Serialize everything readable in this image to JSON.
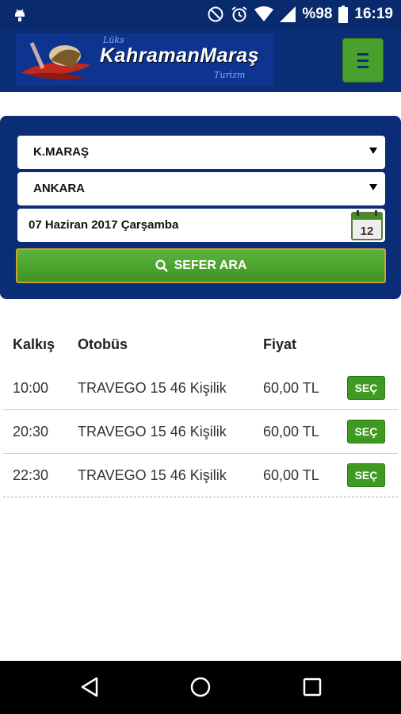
{
  "status_bar": {
    "battery": "%98",
    "time": "16:19",
    "icons": [
      "android-debug-icon",
      "do-not-disturb-icon",
      "alarm-icon",
      "wifi-icon",
      "signal-icon",
      "battery-icon"
    ]
  },
  "header": {
    "logo_tag_top": "Lüks",
    "logo_brand": "KahramanMaraş",
    "logo_tag_bottom": "Turizm",
    "menu_icon": "hamburger-icon"
  },
  "search": {
    "from": "K.MARAŞ",
    "to": "ANKARA",
    "date": "07 Haziran 2017 Çarşamba",
    "calendar_day": "12",
    "button_label": "SEFER ARA"
  },
  "results": {
    "headers": {
      "departure": "Kalkış",
      "bus": "Otobüs",
      "price": "Fiyat"
    },
    "rows": [
      {
        "time": "10:00",
        "bus": "TRAVEGO 15 46 Kişilik",
        "price": "60,00 TL",
        "action": "SEÇ"
      },
      {
        "time": "20:30",
        "bus": "TRAVEGO 15 46 Kişilik",
        "price": "60,00 TL",
        "action": "SEÇ"
      },
      {
        "time": "22:30",
        "bus": "TRAVEGO 15 46 Kişilik",
        "price": "60,00 TL",
        "action": "SEÇ"
      }
    ]
  },
  "colors": {
    "header_blue": "#0b2d78",
    "button_green": "#3e9a20",
    "status_blue": "#0a2a6e"
  }
}
